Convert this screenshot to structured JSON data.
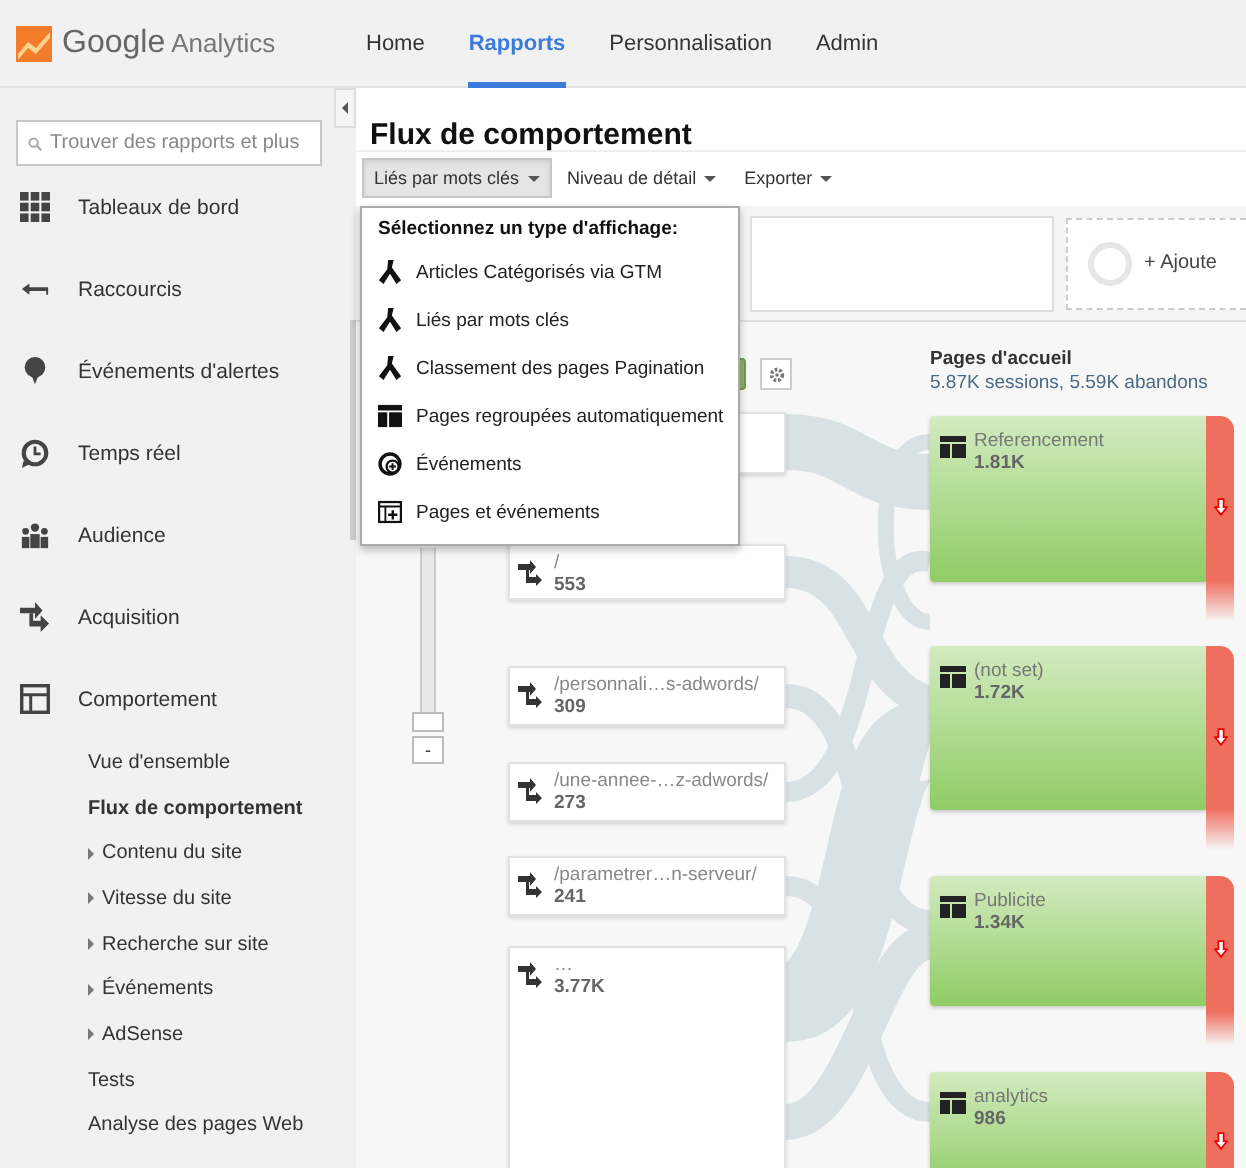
{
  "header": {
    "logo_brand": "Google",
    "logo_product": "Analytics"
  },
  "nav": [
    {
      "label": "Home",
      "selected": false
    },
    {
      "label": "Rapports",
      "selected": true
    },
    {
      "label": "Personnalisation",
      "selected": false
    },
    {
      "label": "Admin",
      "selected": false
    }
  ],
  "sidebar": {
    "search": {
      "placeholder": "Trouver des rapports et plus"
    },
    "items": [
      {
        "label": "Tableaux de bord"
      },
      {
        "label": "Raccourcis"
      },
      {
        "label": "Événements d'alertes"
      },
      {
        "label": "Temps réel"
      },
      {
        "label": "Audience"
      },
      {
        "label": "Acquisition"
      },
      {
        "label": "Comportement",
        "children": [
          {
            "label": "Vue d'ensemble",
            "selected": false,
            "expandable": false
          },
          {
            "label": "Flux de comportement",
            "selected": true,
            "expandable": false
          },
          {
            "label": "Contenu du site",
            "selected": false,
            "expandable": true
          },
          {
            "label": "Vitesse du site",
            "selected": false,
            "expandable": true
          },
          {
            "label": "Recherche sur site",
            "selected": false,
            "expandable": true
          },
          {
            "label": "Événements",
            "selected": false,
            "expandable": true
          },
          {
            "label": "AdSense",
            "selected": false,
            "expandable": true
          },
          {
            "label": "Tests",
            "selected": false,
            "expandable": false
          },
          {
            "label": "Analyse des pages Web",
            "selected": false,
            "expandable": false
          }
        ]
      }
    ]
  },
  "page": {
    "title": "Flux de comportement"
  },
  "toolbar": [
    {
      "label": "Liés par mots clés",
      "pressed": true
    },
    {
      "label": "Niveau de détail",
      "pressed": false
    },
    {
      "label": "Exporter",
      "pressed": false
    }
  ],
  "segments": {
    "add_label": "+ Ajoute"
  },
  "dropdown": {
    "heading": "Sélectionnez un type d'affichage:",
    "options": [
      {
        "label": "Articles Catégorisés via GTM",
        "kind": "flow"
      },
      {
        "label": "Liés par mots clés",
        "kind": "flow"
      },
      {
        "label": "Classement des pages Pagination",
        "kind": "flow"
      },
      {
        "label": "Pages regroupées automatiquement",
        "kind": "grouped"
      },
      {
        "label": "Événements",
        "kind": "event"
      },
      {
        "label": "Pages et événements",
        "kind": "page-event"
      }
    ]
  },
  "flow": {
    "zoom_out": "-",
    "zoom": {
      "level": 1
    },
    "sources": [
      {
        "label": "/",
        "value": "553"
      },
      {
        "label": "/personnali…s-adwords/",
        "value": "309"
      },
      {
        "label": "/une-annee-…z-adwords/",
        "value": "273"
      },
      {
        "label": "/parametrer…n-serveur/",
        "value": "241"
      },
      {
        "label": "…",
        "value": "3.77K"
      }
    ],
    "landing": {
      "title": "Pages d'accueil",
      "subtitle": "5.87K sessions, 5.59K abandons",
      "nodes": [
        {
          "label": "Referencement",
          "value": "1.81K"
        },
        {
          "label": "(not set)",
          "value": "1.72K"
        },
        {
          "label": "Publicite",
          "value": "1.34K"
        },
        {
          "label": "analytics",
          "value": "986"
        }
      ]
    }
  }
}
